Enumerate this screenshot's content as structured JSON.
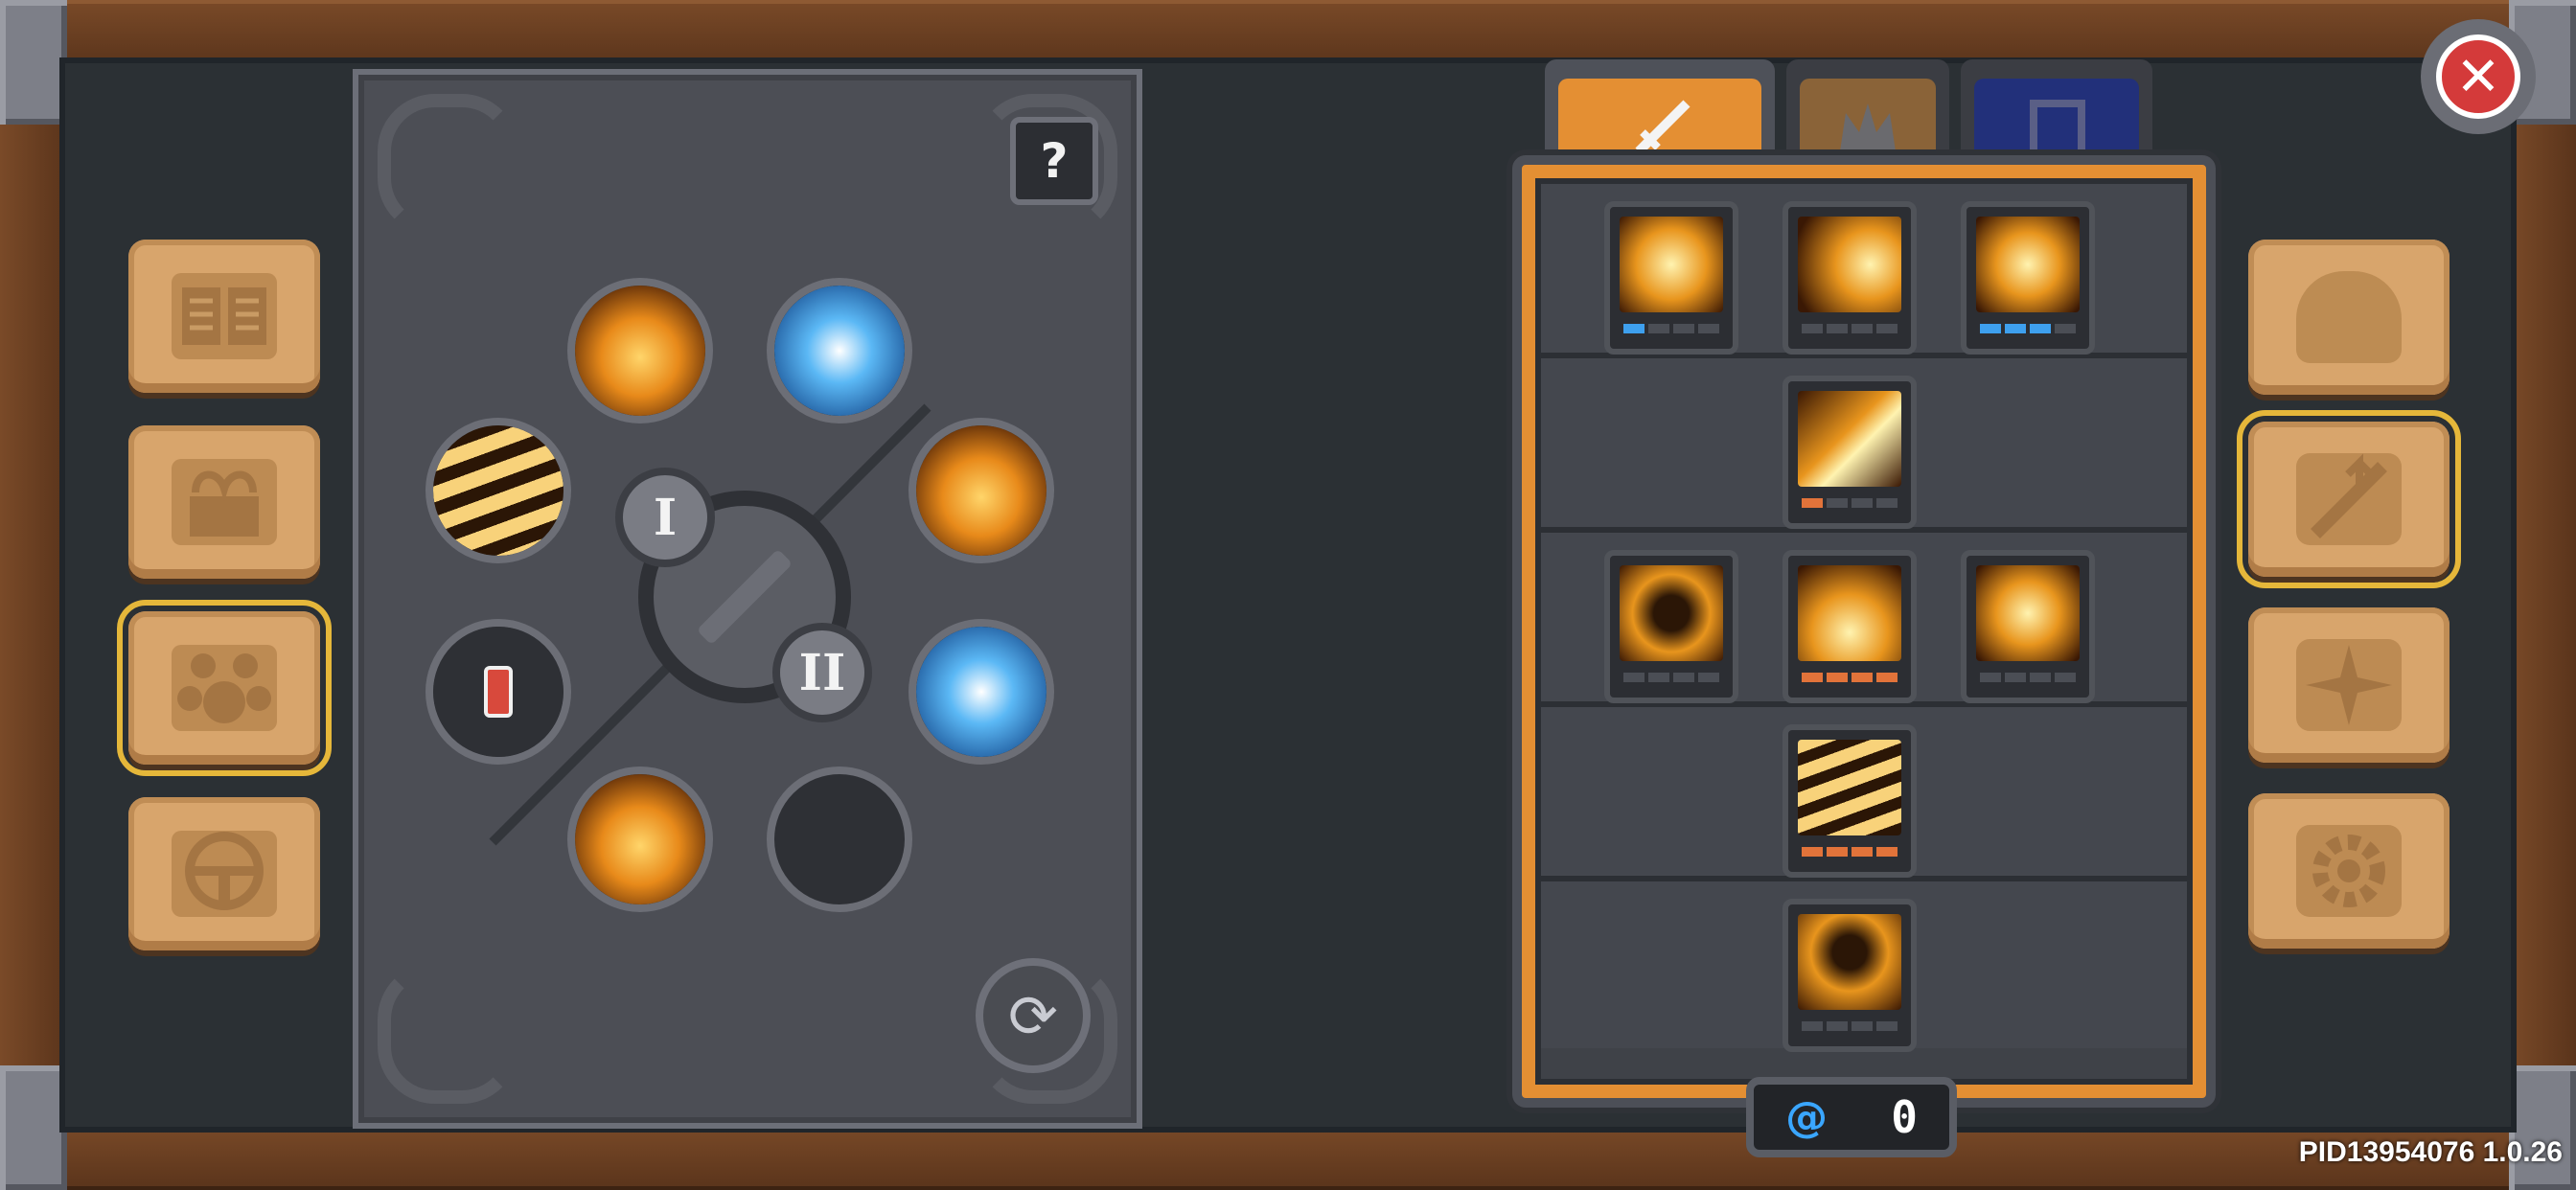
{
  "help_label": "?",
  "close_label": "✕",
  "tree": {
    "numeral_1": "I",
    "numeral_2": "II",
    "refresh_label": "⟳"
  },
  "currency": {
    "icon": "spiral-icon",
    "amount": "0"
  },
  "version": "PID13954076 1.0.26",
  "left_tabs": [
    "book-icon",
    "gift-box-icon",
    "paw-icon",
    "bell-icon"
  ],
  "right_tabs": [
    "helmet-icon",
    "sword-upgrade-icon",
    "compass-icon",
    "gear-icon"
  ],
  "skill_tabs": [
    "sword-tab-icon",
    "crown-tab-icon",
    "banner-tab-icon"
  ],
  "colors": {
    "panel_orange": "#e48f33",
    "level_blue": "#3ea0ee",
    "level_orange": "#e2733a",
    "close_red": "#d43a3a"
  }
}
